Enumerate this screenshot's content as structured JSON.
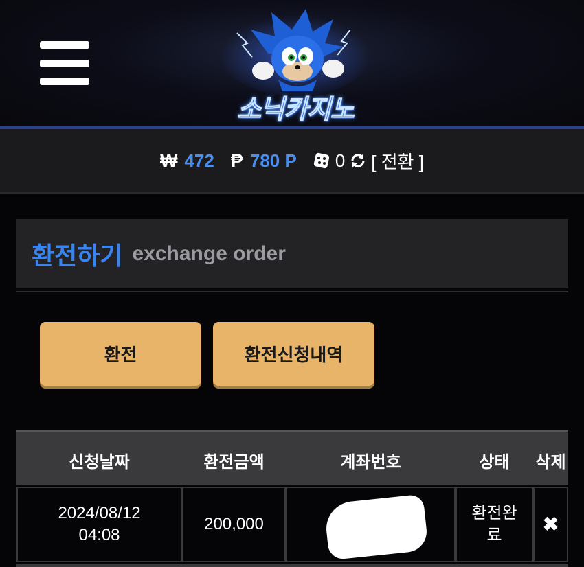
{
  "header": {
    "menu_icon": "hamburger-menu-icon",
    "logo_text": "소닉카지노",
    "logo_mascot": "sonic-mascot-icon"
  },
  "balance": {
    "won_symbol": "₩",
    "won_value": "472",
    "point_symbol": "₱",
    "point_value": "780 P",
    "dice_value": "0",
    "exchange_label": "[ 전환 ]"
  },
  "section": {
    "title_ko": "환전하기",
    "title_en": "exchange order"
  },
  "buttons": {
    "exchange": "환전",
    "history": "환전신청내역"
  },
  "table": {
    "headers": [
      "신청날짜",
      "환전금액",
      "계좌번호",
      "상태",
      "삭제"
    ],
    "rows": [
      {
        "date_line1": "2024/08/12",
        "date_line2": "04:08",
        "amount": "200,000",
        "account": "",
        "status_line1": "환전완",
        "status_line2": "료",
        "delete": "✖"
      }
    ]
  },
  "colors": {
    "accent_blue": "#3a84f0",
    "button_gold": "#e8b46a",
    "header_line": "#2a3f8f"
  }
}
